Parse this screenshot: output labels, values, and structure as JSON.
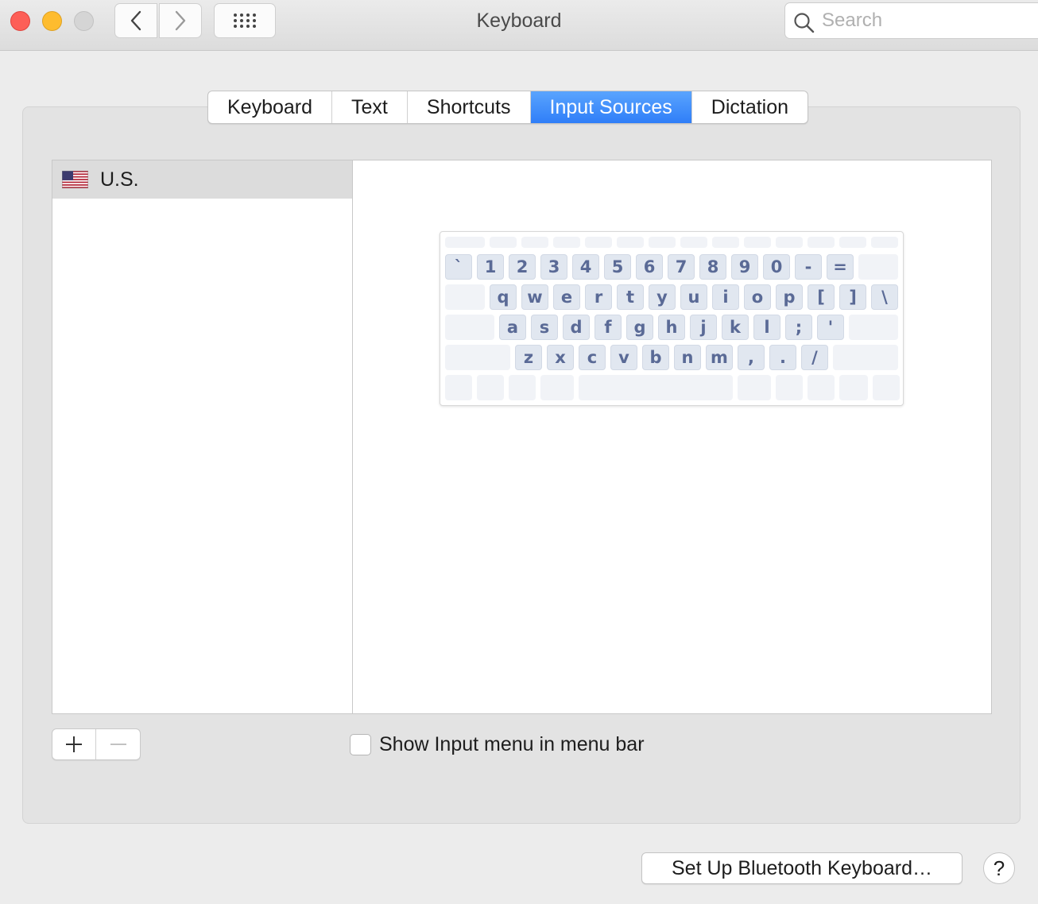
{
  "window": {
    "title": "Keyboard"
  },
  "search": {
    "placeholder": "Search"
  },
  "tabs": [
    {
      "label": "Keyboard",
      "active": false
    },
    {
      "label": "Text",
      "active": false
    },
    {
      "label": "Shortcuts",
      "active": false
    },
    {
      "label": "Input Sources",
      "active": true
    },
    {
      "label": "Dictation",
      "active": false
    }
  ],
  "input_sources": [
    {
      "label": "U.S.",
      "icon": "us-flag-icon",
      "selected": true
    }
  ],
  "keyboard_preview": {
    "rows": [
      [
        "`",
        "1",
        "2",
        "3",
        "4",
        "5",
        "6",
        "7",
        "8",
        "9",
        "0",
        "-",
        "="
      ],
      [
        "q",
        "w",
        "e",
        "r",
        "t",
        "y",
        "u",
        "i",
        "o",
        "p",
        "[",
        "]",
        "\\"
      ],
      [
        "a",
        "s",
        "d",
        "f",
        "g",
        "h",
        "j",
        "k",
        "l",
        ";",
        "'"
      ],
      [
        "z",
        "x",
        "c",
        "v",
        "b",
        "n",
        "m",
        ",",
        ".",
        "/"
      ]
    ]
  },
  "controls": {
    "add_icon": "plus-icon",
    "remove_icon": "minus-icon",
    "show_input_menu_label": "Show Input menu in menu bar",
    "show_input_menu_checked": false,
    "bluetooth_button": "Set Up Bluetooth Keyboard…",
    "help_label": "?"
  },
  "colors": {
    "accent": "#3b87f9",
    "key_text": "#5a6a96"
  }
}
